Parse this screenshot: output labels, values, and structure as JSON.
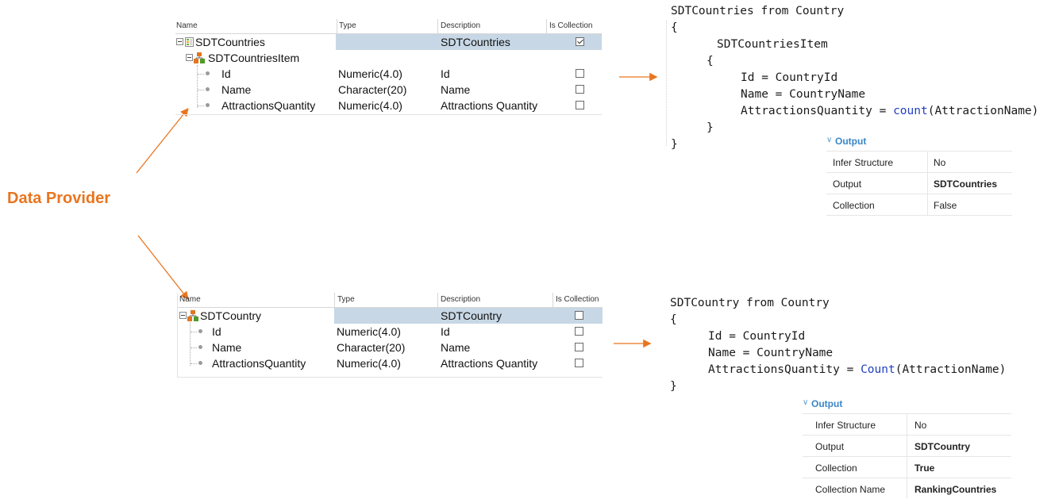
{
  "label": "Data Provider",
  "colors": {
    "accent": "#e9751f",
    "selection": "#c7d7e5",
    "keyword": "#1f3fbf",
    "output_title": "#3a86c8"
  },
  "grid_headers": {
    "name": "Name",
    "type": "Type",
    "description": "Description",
    "is_collection": "Is Collection"
  },
  "top_grid": {
    "rows": [
      {
        "name": "SDTCountries",
        "type": "",
        "description": "SDTCountries",
        "collection": true,
        "icon": "sdt-root-icon"
      },
      {
        "name": "SDTCountriesItem",
        "type": "",
        "description": "",
        "collection": null,
        "icon": "structure-icon"
      },
      {
        "name": "Id",
        "type": "Numeric(4.0)",
        "description": "Id",
        "collection": false,
        "icon": "attribute-dot-icon"
      },
      {
        "name": "Name",
        "type": "Character(20)",
        "description": "Name",
        "collection": false,
        "icon": "attribute-dot-icon"
      },
      {
        "name": "AttractionsQuantity",
        "type": "Numeric(4.0)",
        "description": "Attractions Quantity",
        "collection": false,
        "icon": "attribute-dot-icon"
      }
    ]
  },
  "bottom_grid": {
    "rows": [
      {
        "name": "SDTCountry",
        "type": "",
        "description": "SDTCountry",
        "collection": false,
        "icon": "structure-icon"
      },
      {
        "name": "Id",
        "type": "Numeric(4.0)",
        "description": "Id",
        "collection": false,
        "icon": "attribute-dot-icon"
      },
      {
        "name": "Name",
        "type": "Character(20)",
        "description": "Name",
        "collection": false,
        "icon": "attribute-dot-icon"
      },
      {
        "name": "AttractionsQuantity",
        "type": "Numeric(4.0)",
        "description": "Attractions Quantity",
        "collection": false,
        "icon": "attribute-dot-icon"
      }
    ]
  },
  "top_code": {
    "l1": "SDTCountries from Country",
    "l2": "{",
    "l3": "SDTCountriesItem",
    "l4": "{",
    "l5": "Id = CountryId",
    "l6": "Name = CountryName",
    "l7_pre": "AttractionsQuantity = ",
    "l7_fn": "count",
    "l7_post": "(AttractionName)",
    "l8": "}",
    "l9": "}"
  },
  "bottom_code": {
    "l1": "SDTCountry from Country",
    "l2": "{",
    "l3": "Id = CountryId",
    "l4": "Name = CountryName",
    "l5_pre": "AttractionsQuantity = ",
    "l5_fn": "Count",
    "l5_post": "(AttractionName)",
    "l6": "}"
  },
  "top_props": {
    "title": "Output",
    "rows": [
      {
        "key": "Infer Structure",
        "value": "No",
        "bold": false
      },
      {
        "key": "Output",
        "value": "SDTCountries",
        "bold": true
      },
      {
        "key": "Collection",
        "value": "False",
        "bold": false
      }
    ]
  },
  "bottom_props": {
    "title": "Output",
    "rows": [
      {
        "key": "Infer Structure",
        "value": "No",
        "bold": false
      },
      {
        "key": "Output",
        "value": "SDTCountry",
        "bold": true
      },
      {
        "key": "Collection",
        "value": "True",
        "bold": true
      },
      {
        "key": "Collection Name",
        "value": "RankingCountries",
        "bold": true
      }
    ]
  }
}
